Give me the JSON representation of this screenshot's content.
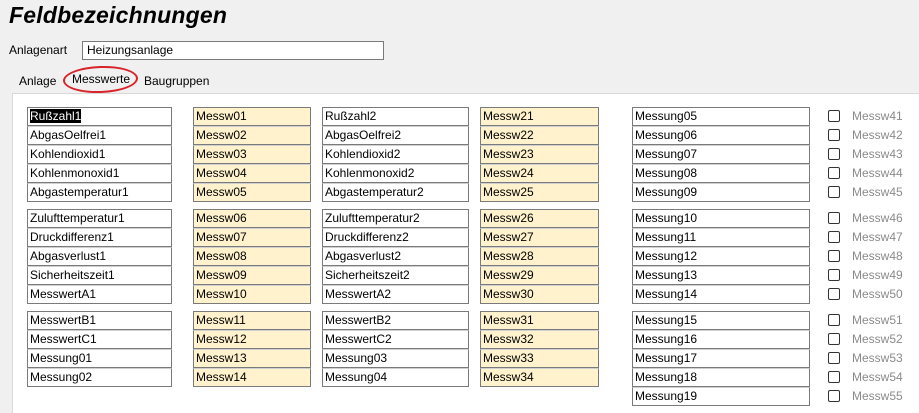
{
  "title": "Feldbezeichnungen",
  "anlagenart": {
    "label": "Anlagenart",
    "value": "Heizungsanlage"
  },
  "tabs": [
    "Anlage",
    "Messwerte",
    "Baugruppen"
  ],
  "columns": {
    "c1": [
      [
        "Rußzahl1",
        "AbgasOelfrei1",
        "Kohlendioxid1",
        "Kohlenmonoxid1",
        "Abgastemperatur1"
      ],
      [
        "Zulufttemperatur1",
        "Druckdifferenz1",
        "Abgasverlust1",
        "Sicherheitszeit1",
        "MesswertA1"
      ],
      [
        "MesswertB1",
        "MesswertC1",
        "Messung01",
        "Messung02"
      ]
    ],
    "c2": [
      [
        "Messw01",
        "Messw02",
        "Messw03",
        "Messw04",
        "Messw05"
      ],
      [
        "Messw06",
        "Messw07",
        "Messw08",
        "Messw09",
        "Messw10"
      ],
      [
        "Messw11",
        "Messw12",
        "Messw13",
        "Messw14"
      ]
    ],
    "c3": [
      [
        "Rußzahl2",
        "AbgasOelfrei2",
        "Kohlendioxid2",
        "Kohlenmonoxid2",
        "Abgastemperatur2"
      ],
      [
        "Zulufttemperatur2",
        "Druckdifferenz2",
        "Abgasverlust2",
        "Sicherheitszeit2",
        "MesswertA2"
      ],
      [
        "MesswertB2",
        "MesswertC2",
        "Messung03",
        "Messung04"
      ]
    ],
    "c4": [
      [
        "Messw21",
        "Messw22",
        "Messw23",
        "Messw24",
        "Messw25"
      ],
      [
        "Messw26",
        "Messw27",
        "Messw28",
        "Messw29",
        "Messw30"
      ],
      [
        "Messw31",
        "Messw32",
        "Messw33",
        "Messw34"
      ]
    ],
    "c5": [
      [
        "Messung05",
        "Messung06",
        "Messung07",
        "Messung08",
        "Messung09"
      ],
      [
        "Messung10",
        "Messung11",
        "Messung12",
        "Messung13",
        "Messung14"
      ],
      [
        "Messung15",
        "Messung16",
        "Messung17",
        "Messung18",
        "Messung19"
      ]
    ],
    "c6": [
      [
        "Messw41",
        "Messw42",
        "Messw43",
        "Messw44",
        "Messw45"
      ],
      [
        "Messw46",
        "Messw47",
        "Messw48",
        "Messw49",
        "Messw50"
      ],
      [
        "Messw51",
        "Messw52",
        "Messw53",
        "Messw54",
        "Messw55"
      ]
    ]
  }
}
